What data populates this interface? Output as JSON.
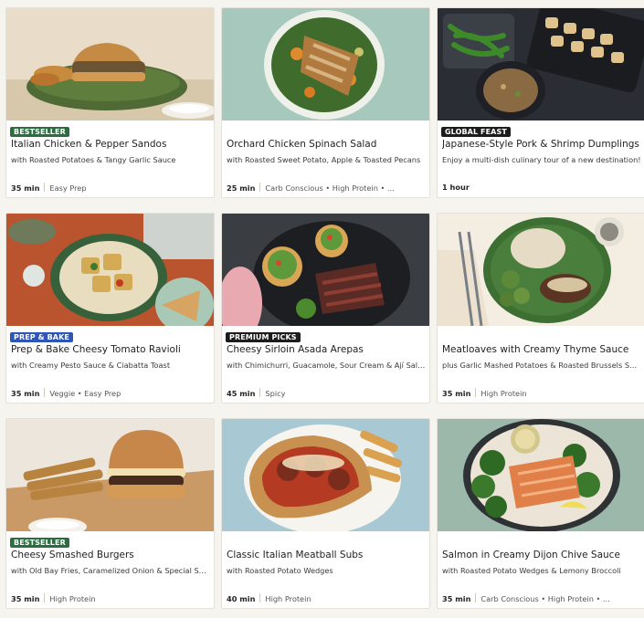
{
  "colors": {
    "bestseller": "#2a6e3f",
    "global": "#1c1c1c",
    "prep": "#2e55b8",
    "premium": "#1c1c1c"
  },
  "cards": [
    {
      "badge": "BESTSELLER",
      "badge_color": "#2a6e3f",
      "title": "Italian Chicken & Pepper Sandos",
      "subtitle": "with Roasted Potatoes & Tangy Garlic Sauce",
      "time": "35 min",
      "tags": "Easy Prep"
    },
    {
      "badge": "",
      "badge_color": "",
      "title": "Orchard Chicken Spinach Salad",
      "subtitle": "with Roasted Sweet Potato, Apple & Toasted Pecans",
      "time": "25 min",
      "tags": "Carb Conscious • High Protein • ..."
    },
    {
      "badge": "GLOBAL FEAST",
      "badge_color": "#1c1c1c",
      "title": "Japanese-Style Pork & Shrimp Dumplings",
      "subtitle": "Enjoy a multi-dish culinary tour of a new destination!",
      "time": "1 hour",
      "tags": ""
    },
    {
      "badge": "PREP & BAKE",
      "badge_color": "#2e55b8",
      "title": "Prep & Bake Cheesy Tomato Ravioli",
      "subtitle": "with Creamy Pesto Sauce & Ciabatta Toast",
      "time": "35 min",
      "tags": "Veggie • Easy Prep"
    },
    {
      "badge": "PREMIUM PICKS",
      "badge_color": "#1c1c1c",
      "title": "Cheesy Sirloin Asada Arepas",
      "subtitle": "with Chimichurri, Guacamole, Sour Cream & Ají Salsa",
      "time": "45 min",
      "tags": "Spicy"
    },
    {
      "badge": "",
      "badge_color": "",
      "title": "Meatloaves with Creamy Thyme Sauce",
      "subtitle": "plus Garlic Mashed Potatoes & Roasted Brussels Spr...",
      "time": "35 min",
      "tags": "High Protein"
    },
    {
      "badge": "BESTSELLER",
      "badge_color": "#2a6e3f",
      "title": "Cheesy Smashed Burgers",
      "subtitle": "with Old Bay Fries, Caramelized Onion & Special Sa...",
      "time": "35 min",
      "tags": "High Protein"
    },
    {
      "badge": "",
      "badge_color": "",
      "title": "Classic Italian Meatball Subs",
      "subtitle": "with Roasted Potato Wedges",
      "time": "40 min",
      "tags": "High Protein"
    },
    {
      "badge": "",
      "badge_color": "",
      "title": "Salmon in Creamy Dijon Chive Sauce",
      "subtitle": "with Roasted Potato Wedges & Lemony Broccoli",
      "time": "35 min",
      "tags": "Carb Conscious • High Protein • ..."
    }
  ]
}
